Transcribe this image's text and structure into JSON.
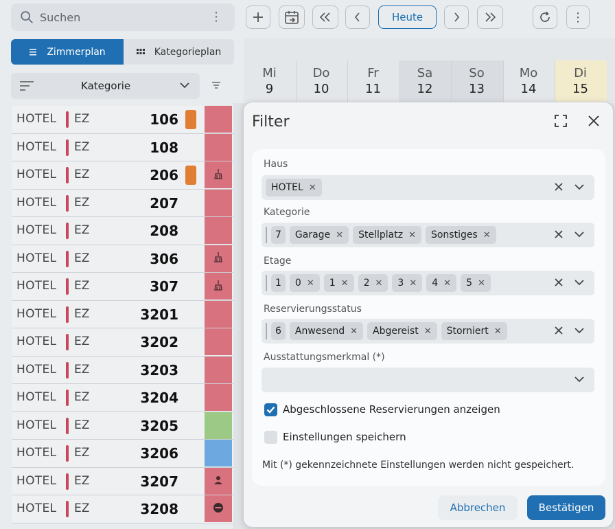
{
  "toolbar": {
    "search_placeholder": "Suchen",
    "today_label": "Heute"
  },
  "left": {
    "tabs": [
      {
        "label": "Zimmerplan",
        "active": true
      },
      {
        "label": "Kategorieplan",
        "active": false
      }
    ],
    "sort_label": "Kategorie",
    "rooms": [
      {
        "house": "HOTEL",
        "category": "EZ",
        "number": "106",
        "marker": true,
        "status": "red",
        "status_icon": ""
      },
      {
        "house": "HOTEL",
        "category": "EZ",
        "number": "108",
        "marker": false,
        "status": "red",
        "status_icon": ""
      },
      {
        "house": "HOTEL",
        "category": "EZ",
        "number": "206",
        "marker": true,
        "status": "red",
        "status_icon": "broom-icon"
      },
      {
        "house": "HOTEL",
        "category": "EZ",
        "number": "207",
        "marker": false,
        "status": "red",
        "status_icon": ""
      },
      {
        "house": "HOTEL",
        "category": "EZ",
        "number": "208",
        "marker": false,
        "status": "red",
        "status_icon": ""
      },
      {
        "house": "HOTEL",
        "category": "EZ",
        "number": "306",
        "marker": false,
        "status": "red",
        "status_icon": "broom-icon"
      },
      {
        "house": "HOTEL",
        "category": "EZ",
        "number": "307",
        "marker": false,
        "status": "red",
        "status_icon": "broom-icon"
      },
      {
        "house": "HOTEL",
        "category": "EZ",
        "number": "3201",
        "marker": false,
        "status": "red",
        "status_icon": ""
      },
      {
        "house": "HOTEL",
        "category": "EZ",
        "number": "3202",
        "marker": false,
        "status": "red",
        "status_icon": ""
      },
      {
        "house": "HOTEL",
        "category": "EZ",
        "number": "3203",
        "marker": false,
        "status": "red",
        "status_icon": ""
      },
      {
        "house": "HOTEL",
        "category": "EZ",
        "number": "3204",
        "marker": false,
        "status": "red",
        "status_icon": ""
      },
      {
        "house": "HOTEL",
        "category": "EZ",
        "number": "3205",
        "marker": false,
        "status": "green",
        "status_icon": ""
      },
      {
        "house": "HOTEL",
        "category": "EZ",
        "number": "3206",
        "marker": false,
        "status": "blue",
        "status_icon": ""
      },
      {
        "house": "HOTEL",
        "category": "EZ",
        "number": "3207",
        "marker": false,
        "status": "red",
        "status_icon": "person-icon"
      },
      {
        "house": "HOTEL",
        "category": "EZ",
        "number": "3208",
        "marker": false,
        "status": "red",
        "status_icon": "blocked-icon"
      }
    ]
  },
  "calendar": {
    "days": [
      {
        "weekday": "Mi",
        "day": "9",
        "style": "normal"
      },
      {
        "weekday": "Do",
        "day": "10",
        "style": "normal"
      },
      {
        "weekday": "Fr",
        "day": "11",
        "style": "normal"
      },
      {
        "weekday": "Sa",
        "day": "12",
        "style": "weekend"
      },
      {
        "weekday": "So",
        "day": "13",
        "style": "weekend"
      },
      {
        "weekday": "Mo",
        "day": "14",
        "style": "normal"
      },
      {
        "weekday": "Di",
        "day": "15",
        "style": "today"
      }
    ]
  },
  "dialog": {
    "title": "Filter",
    "fields": [
      {
        "label": "Haus",
        "count": "",
        "chips": [
          "HOTEL"
        ]
      },
      {
        "label": "Kategorie",
        "count": "7",
        "chips": [
          "Garage",
          "Stellplatz",
          "Sonstiges"
        ]
      },
      {
        "label": "Etage",
        "count": "1",
        "chips": [
          "0",
          "1",
          "2",
          "3",
          "4",
          "5"
        ]
      },
      {
        "label": "Reservierungsstatus",
        "count": "6",
        "chips": [
          "Anwesend",
          "Abgereist",
          "Storniert"
        ]
      },
      {
        "label": "Ausstattungsmerkmal (*)",
        "count": "",
        "chips": []
      }
    ],
    "checkboxes": [
      {
        "label": "Abgeschlossene Reservierungen anzeigen",
        "checked": true
      },
      {
        "label": "Einstellungen speichern",
        "checked": false
      }
    ],
    "note": "Mit (*) gekennzeichnete Einstellungen werden nicht gespeichert.",
    "cancel_label": "Abbrechen",
    "confirm_label": "Bestätigen"
  },
  "colors": {
    "accent": "#1f6fb2",
    "status_red": "#d9727f",
    "status_green": "#9cc985",
    "status_blue": "#6ea8e0",
    "marker_orange": "#e07e33",
    "category_bar": "#c94559"
  }
}
